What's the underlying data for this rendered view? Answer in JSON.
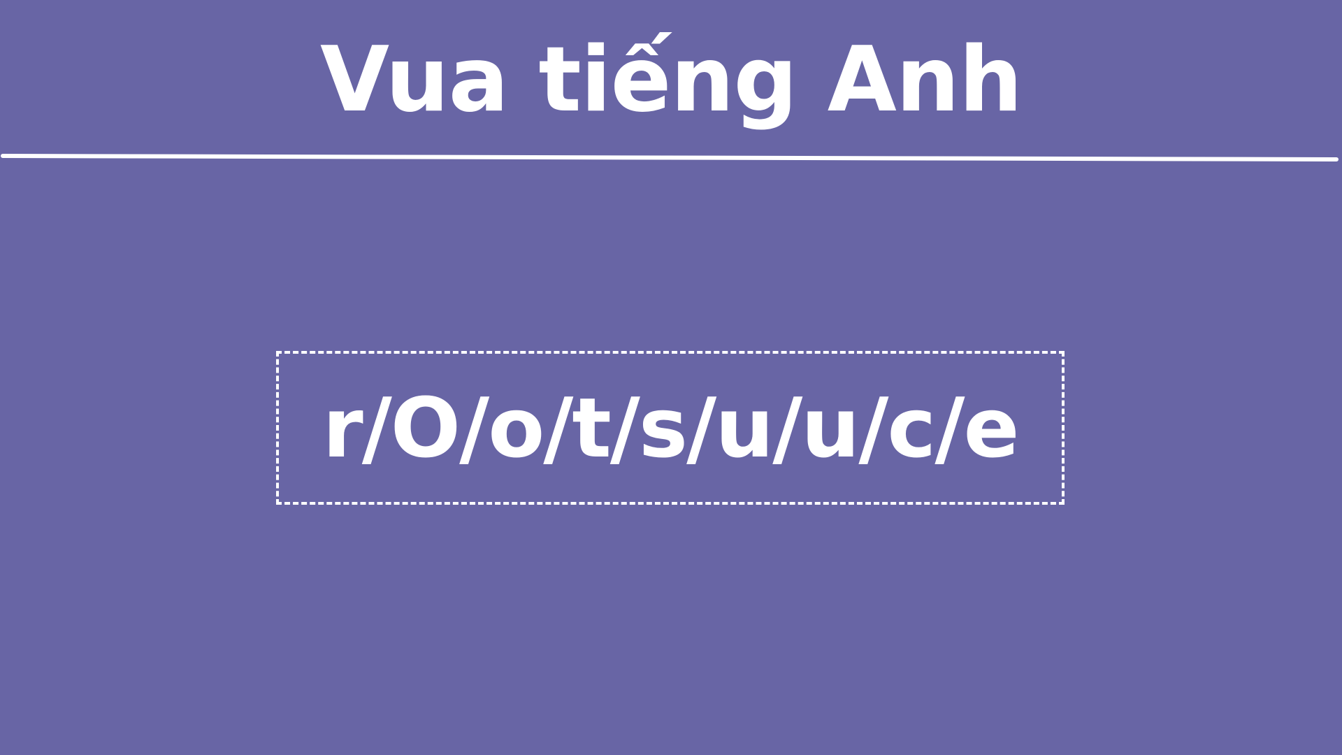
{
  "header": {
    "title": "Vua tiếng Anh"
  },
  "puzzle": {
    "scrambled_word": "r/O/o/t/s/u/u/c/e"
  },
  "colors": {
    "background": "#6865a5",
    "foreground": "#ffffff"
  }
}
